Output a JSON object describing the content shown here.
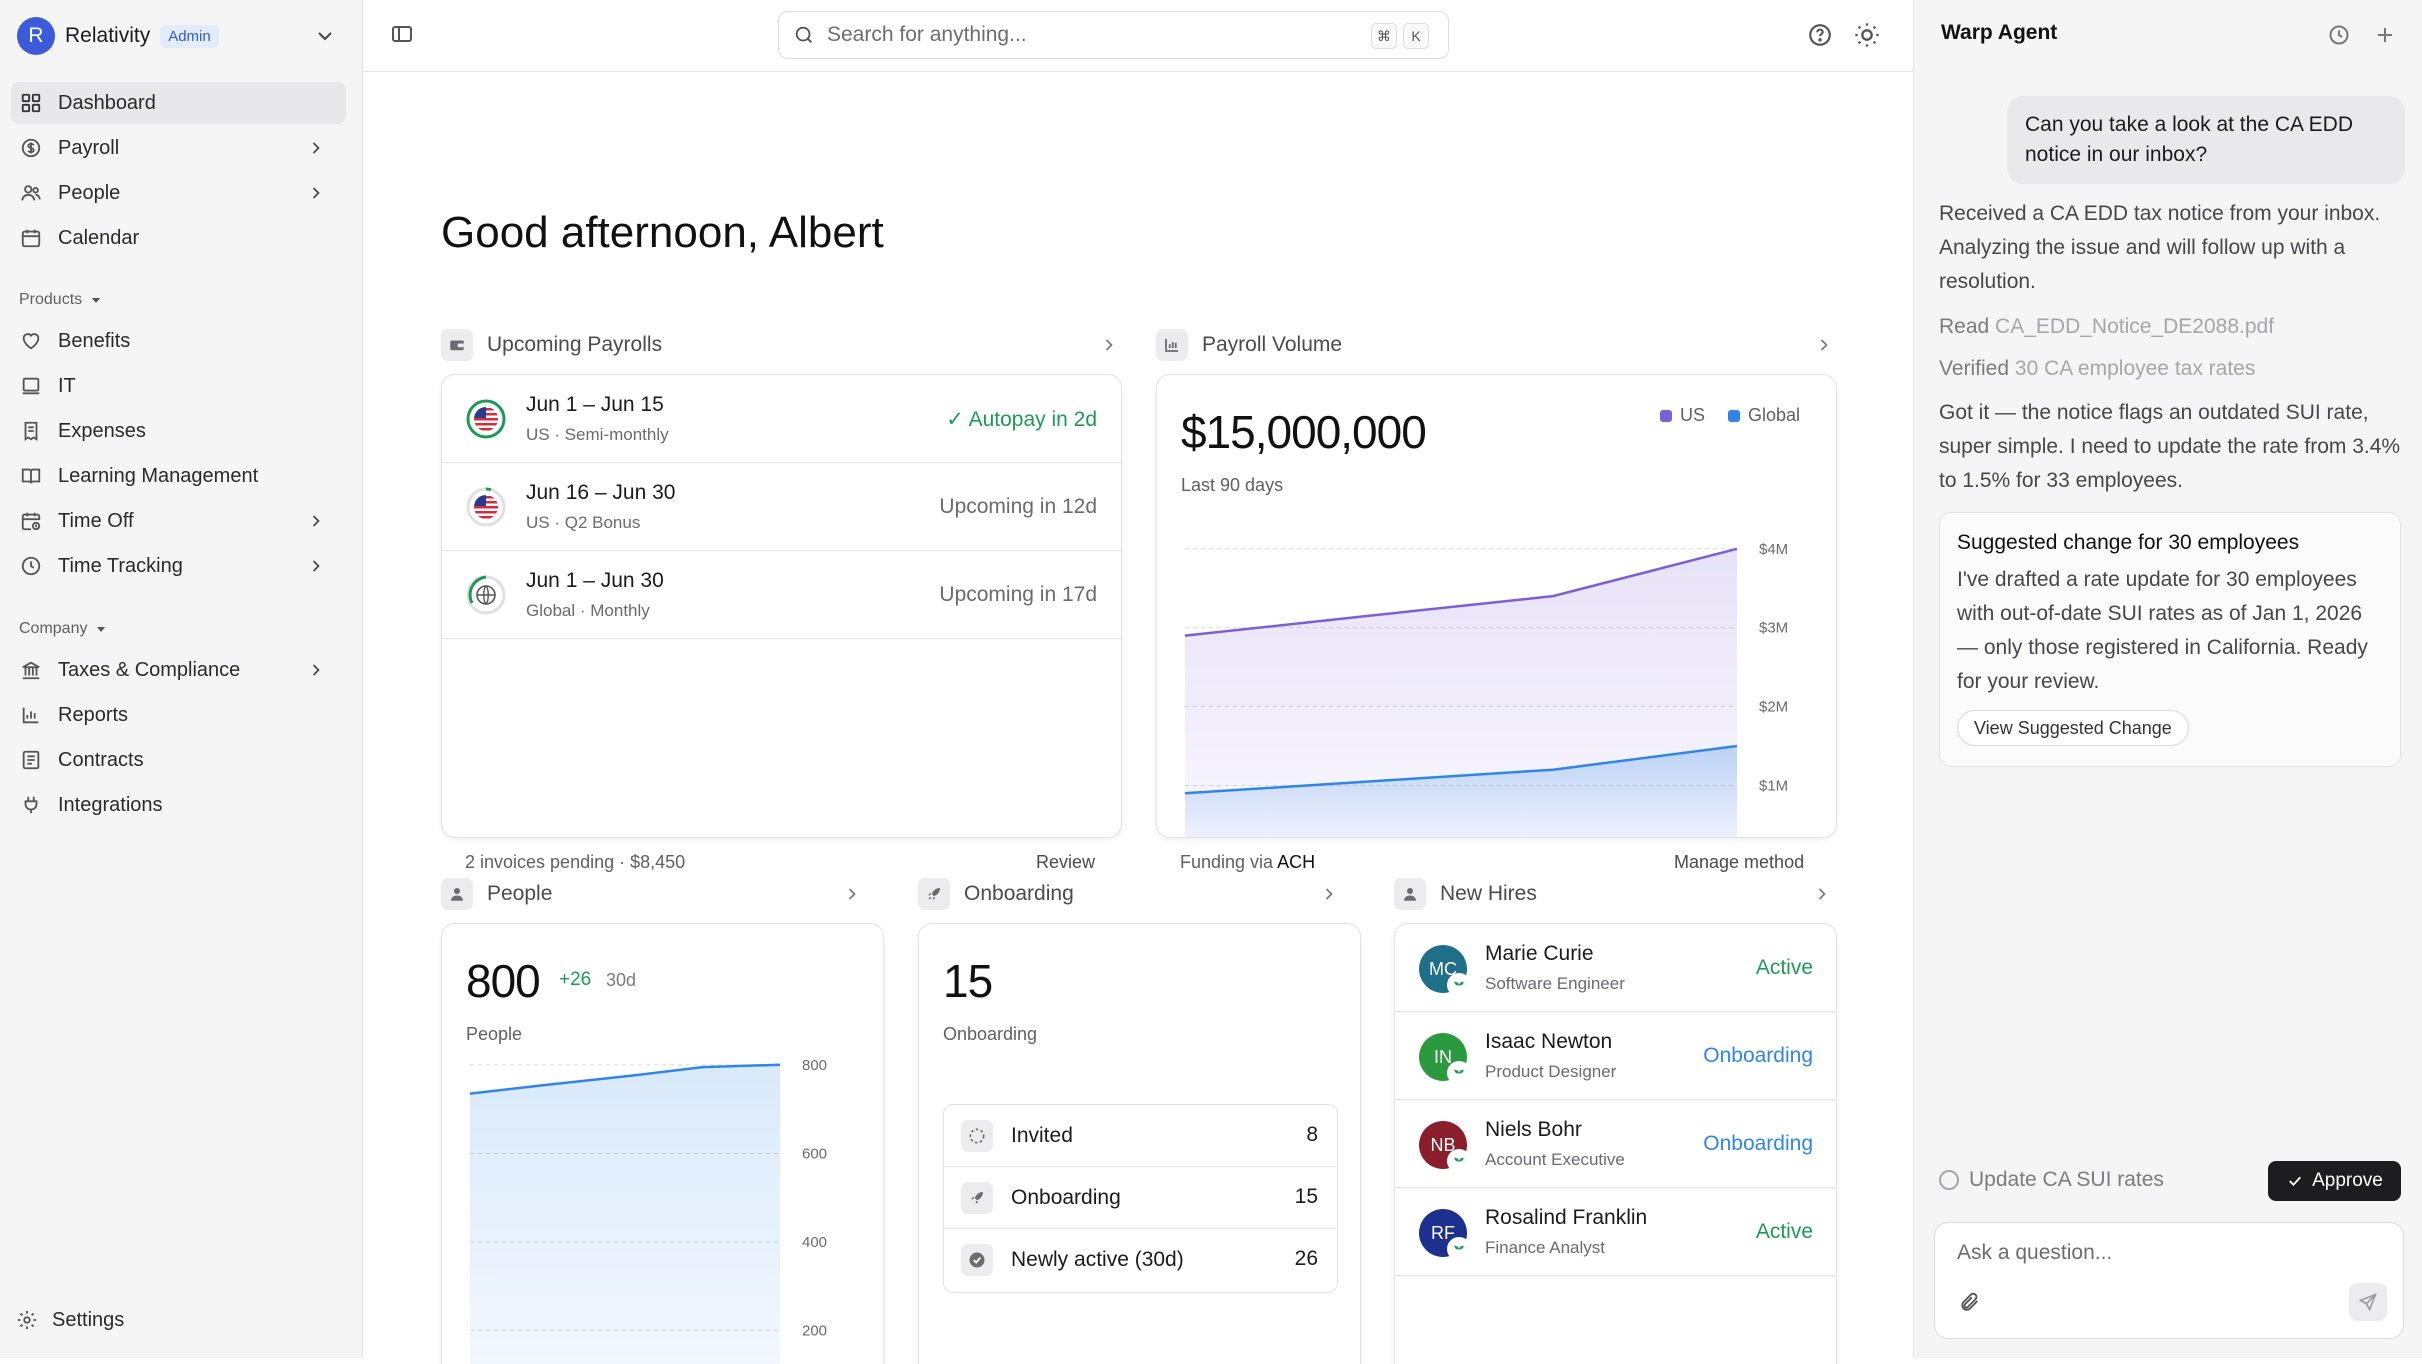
{
  "sidebar": {
    "workspace": {
      "initial": "R",
      "name": "Relativity",
      "badge": "Admin"
    },
    "nav": [
      {
        "label": "Dashboard",
        "icon": "dashboard-icon"
      },
      {
        "label": "Payroll",
        "icon": "dollar-circle-icon"
      },
      {
        "label": "People",
        "icon": "people-icon"
      },
      {
        "label": "Calendar",
        "icon": "calendar-icon"
      }
    ],
    "products_label": "Products",
    "products": [
      {
        "label": "Benefits",
        "icon": "heart-icon"
      },
      {
        "label": "IT",
        "icon": "laptop-icon"
      },
      {
        "label": "Expenses",
        "icon": "receipt-icon"
      },
      {
        "label": "Learning Management",
        "icon": "book-icon"
      },
      {
        "label": "Time Off",
        "icon": "calendar-clock-icon"
      },
      {
        "label": "Time Tracking",
        "icon": "clock-icon"
      }
    ],
    "company_label": "Company",
    "company": [
      {
        "label": "Taxes & Compliance",
        "icon": "bank-icon"
      },
      {
        "label": "Reports",
        "icon": "bar-chart-icon"
      },
      {
        "label": "Contracts",
        "icon": "document-icon"
      },
      {
        "label": "Integrations",
        "icon": "plug-icon"
      }
    ],
    "settings_label": "Settings"
  },
  "topbar": {
    "search_placeholder": "Search for anything...",
    "kbd_cmd": "⌘",
    "kbd_key": "K"
  },
  "main": {
    "greeting": "Good afternoon, Albert",
    "upcoming_payrolls": {
      "title": "Upcoming Payrolls",
      "rows": [
        {
          "period": "Jun 1 – Jun 15",
          "detail": "US · Semi-monthly",
          "status": "✓ Autopay in 2d",
          "flag": "us-flag-icon"
        },
        {
          "period": "Jun 16 – Jun 30",
          "detail": "US · Q2 Bonus",
          "status": "Upcoming in 12d",
          "flag": "us-flag-icon"
        },
        {
          "period": "Jun 1 – Jun 30",
          "detail": "Global · Monthly",
          "status": "Upcoming in 17d",
          "flag": "globe-icon"
        }
      ],
      "footer_left": "2 invoices pending · $8,450",
      "footer_right": "Review"
    },
    "payroll_volume": {
      "title": "Payroll Volume",
      "amount": "$15,000,000",
      "period": "Last 90 days",
      "legend_us": "US",
      "legend_global": "Global",
      "footer_prefix": "Funding via",
      "footer_method": "ACH",
      "footer_right": "Manage method",
      "colors": {
        "us": "#7b5fd6",
        "global": "#2f86e8"
      }
    },
    "people": {
      "title": "People",
      "count": "800",
      "delta": "+26",
      "delta_period": "30d",
      "label": "People"
    },
    "onboarding": {
      "title": "Onboarding",
      "count": "15",
      "label": "Onboarding",
      "rows": [
        {
          "label": "Invited",
          "value": "8",
          "icon": "dashed-circle-icon"
        },
        {
          "label": "Onboarding",
          "value": "15",
          "icon": "rocket-icon"
        },
        {
          "label": "Newly active (30d)",
          "value": "26",
          "icon": "check-circle-icon"
        }
      ]
    },
    "new_hires": {
      "title": "New Hires",
      "rows": [
        {
          "initials": "MC",
          "name": "Marie Curie",
          "role": "Software Engineer",
          "status": "Active",
          "color": "#1f6f8b"
        },
        {
          "initials": "IN",
          "name": "Isaac Newton",
          "role": "Product Designer",
          "status": "Onboarding",
          "color": "#2b9a3e"
        },
        {
          "initials": "NB",
          "name": "Niels Bohr",
          "role": "Account Executive",
          "status": "Onboarding",
          "color": "#8b1e2b"
        },
        {
          "initials": "RF",
          "name": "Rosalind Franklin",
          "role": "Finance Analyst",
          "status": "Active",
          "color": "#1d2f8f"
        }
      ]
    }
  },
  "chart_data": [
    {
      "type": "area",
      "title": "Payroll Volume",
      "x": [
        1,
        2,
        3,
        4
      ],
      "series": [
        {
          "name": "US",
          "values": [
            2.9,
            3.15,
            3.4,
            4.0
          ]
        },
        {
          "name": "Global",
          "values": [
            0.9,
            1.05,
            1.2,
            1.5
          ]
        }
      ],
      "y_ticks": [
        "$4M",
        "$3M",
        "$2M",
        "$1M"
      ],
      "ylim": [
        0.6,
        4.2
      ],
      "grid": true
    },
    {
      "type": "area",
      "title": "People",
      "x": [
        1,
        2,
        3,
        4,
        5
      ],
      "series": [
        {
          "name": "People",
          "values": [
            735,
            755,
            774,
            795,
            800
          ]
        }
      ],
      "y_ticks": [
        "800",
        "600",
        "400",
        "200"
      ],
      "ylim": [
        160,
        820
      ],
      "grid": true
    }
  ],
  "agent": {
    "title": "Warp Agent",
    "user_message": "Can you take a look at the CA EDD notice in our inbox?",
    "reply1": "Received a CA EDD tax notice from your inbox. Analyzing the issue and will follow up with a resolution.",
    "step1_verb": "Read",
    "step1_obj": "CA_EDD_Notice_DE2088.pdf",
    "step2_verb": "Verified",
    "step2_obj": "30 CA employee tax rates",
    "reply2": "Got it — the notice flags an outdated SUI rate, super simple. I need to update the rate from 3.4% to 1.5% for 33 employees.",
    "suggestion_title": "Suggested change for 30 employees",
    "suggestion_body": "I've drafted a rate update for 30 employees with out-of-date SUI rates as of Jan 1, 2026 — only those registered in California. Ready for your review.",
    "suggestion_button": "View Suggested Change",
    "task_label": "Update CA SUI rates",
    "approve_label": "Approve",
    "ask_placeholder": "Ask a question..."
  }
}
